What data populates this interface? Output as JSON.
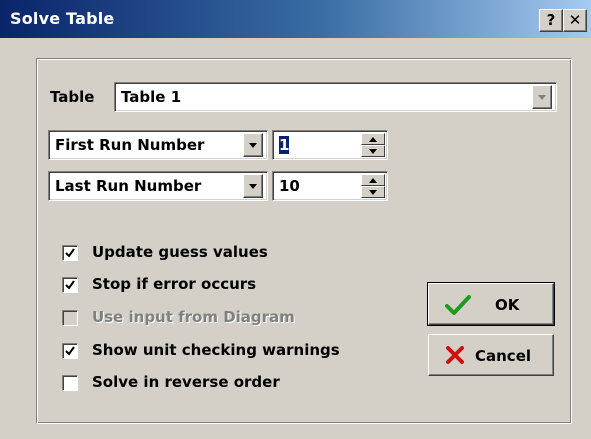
{
  "window": {
    "title": "Solve Table",
    "help_button": "?",
    "close_button": "✕"
  },
  "table_row": {
    "label": "Table",
    "selected": "Table 1"
  },
  "first_run": {
    "selector": "First Run Number",
    "value": "1"
  },
  "last_run": {
    "selector": "Last Run Number",
    "value": "10"
  },
  "options": [
    {
      "label": "Update guess values",
      "checked": true,
      "enabled": true
    },
    {
      "label": "Stop if error occurs",
      "checked": true,
      "enabled": true
    },
    {
      "label": "Use input from Diagram",
      "checked": false,
      "enabled": false
    },
    {
      "label": "Show unit checking warnings",
      "checked": true,
      "enabled": true
    },
    {
      "label": "Solve in reverse order",
      "checked": false,
      "enabled": true
    }
  ],
  "buttons": {
    "ok_label": "OK",
    "ok_icon": "green-checkmark-icon",
    "cancel_label": "Cancel",
    "cancel_icon": "red-x-icon"
  },
  "colors": {
    "title_gradient_start": "#0a246a",
    "title_gradient_end": "#a6caf0",
    "ok_icon": "#1e9a1e",
    "cancel_icon": "#d01010"
  }
}
